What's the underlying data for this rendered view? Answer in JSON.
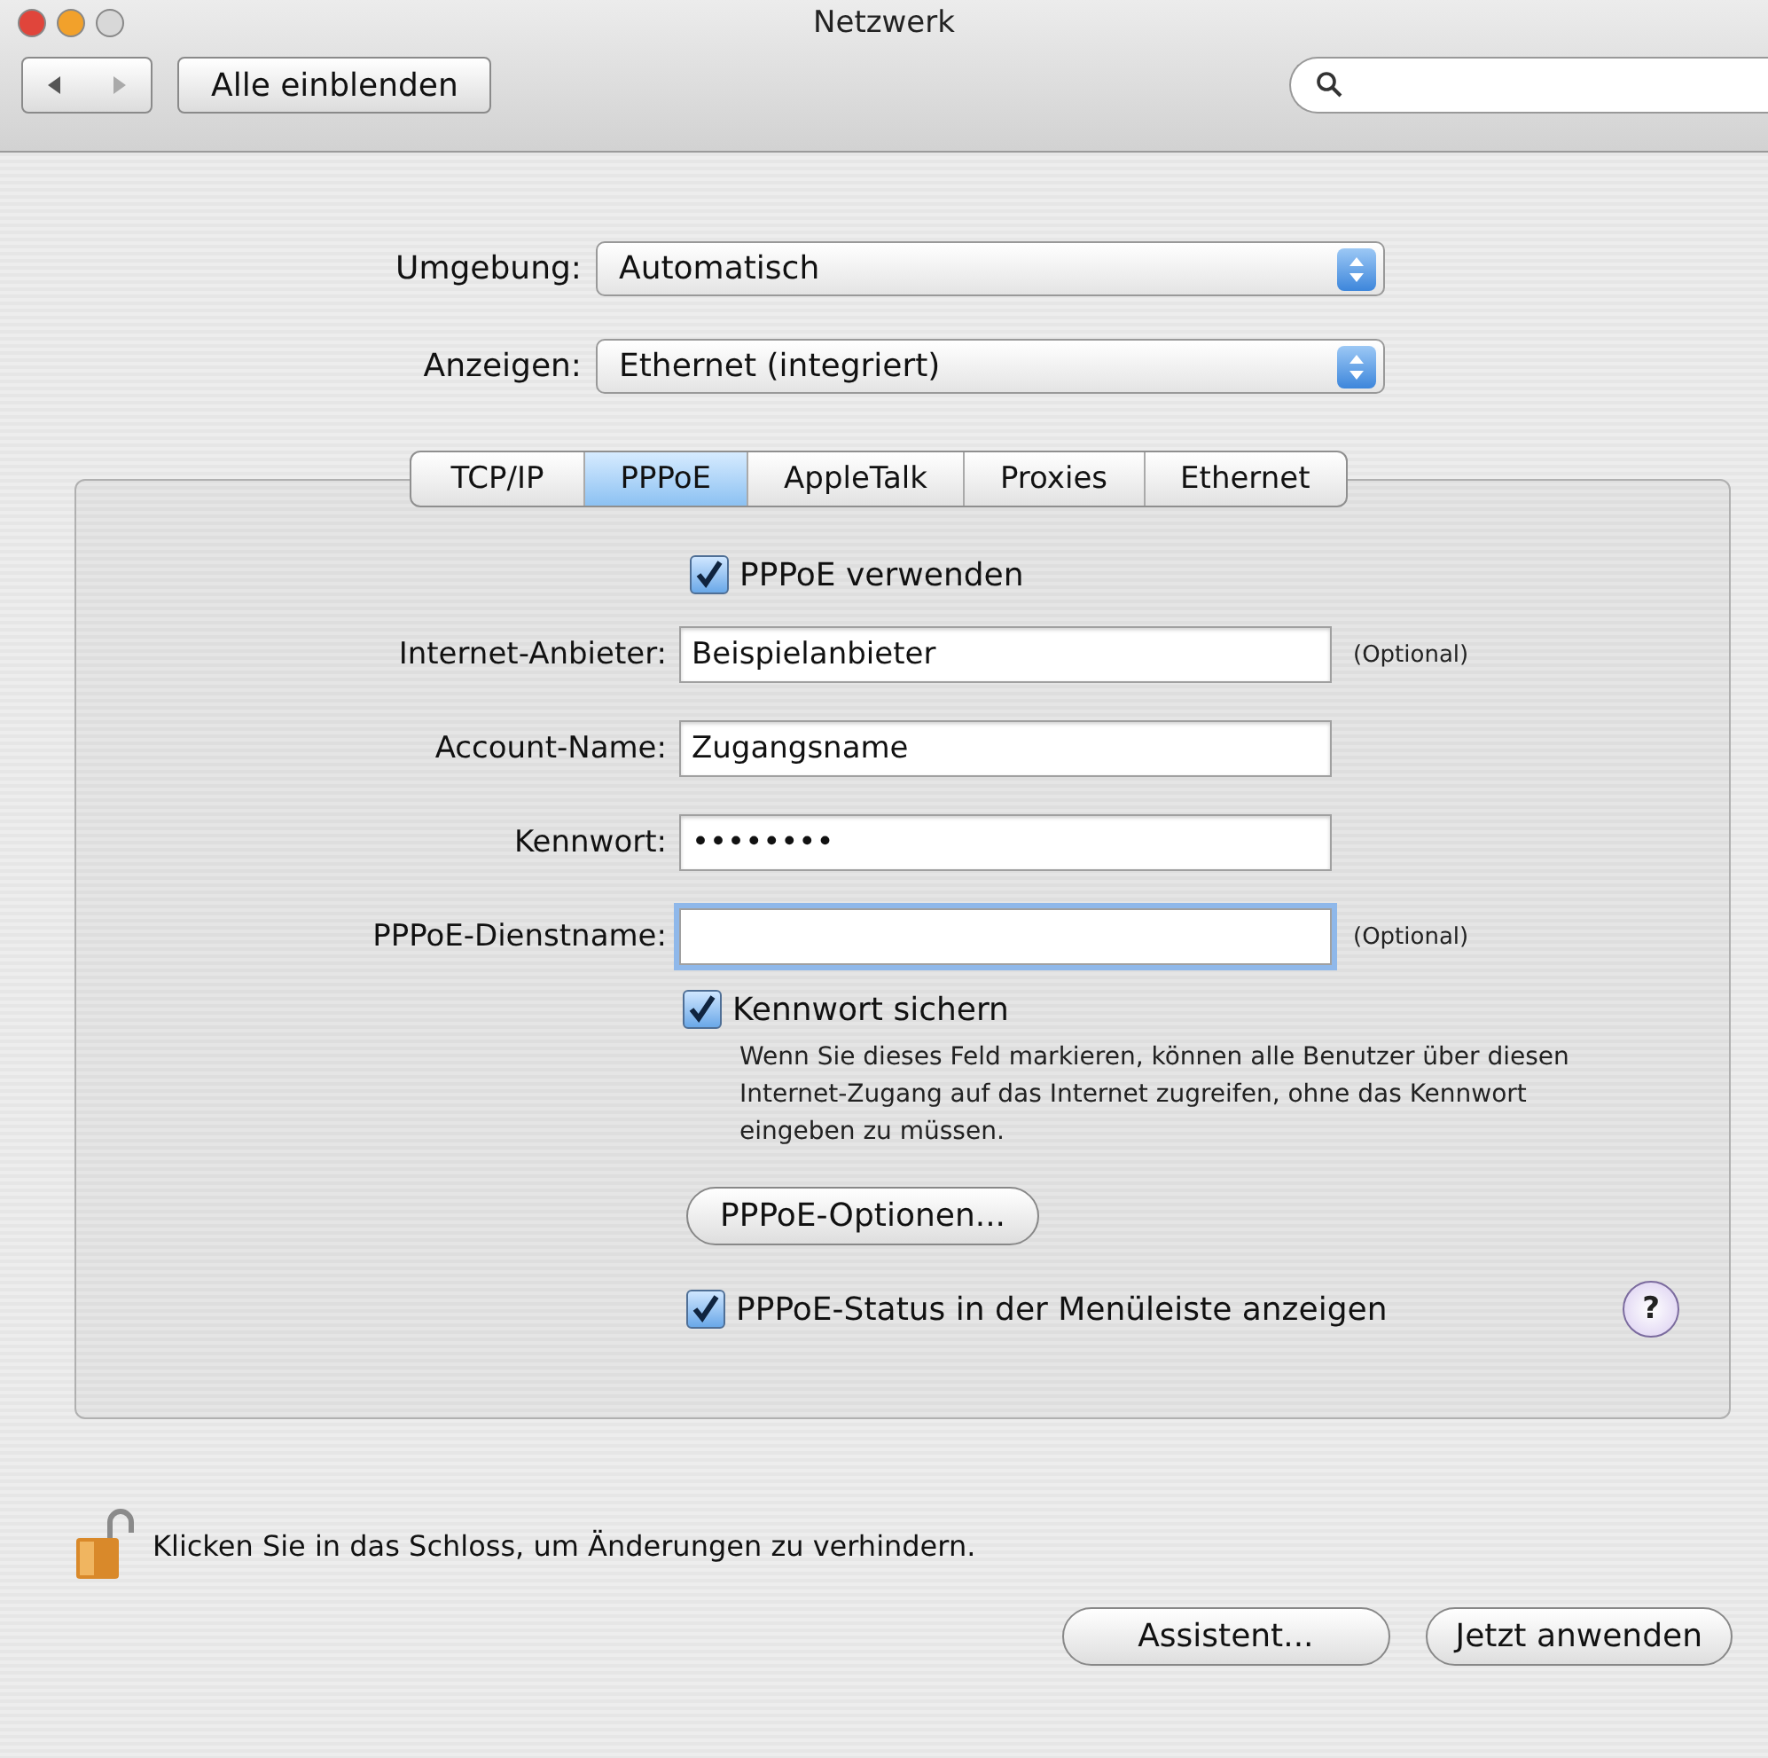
{
  "window": {
    "title": "Netzwerk"
  },
  "toolbar": {
    "show_all": "Alle einblenden"
  },
  "popups": [
    {
      "label": "Umgebung:",
      "value": "Automatisch"
    },
    {
      "label": "Anzeigen:",
      "value": "Ethernet (integriert)"
    }
  ],
  "tabs": [
    {
      "label": "TCP/IP",
      "selected": false
    },
    {
      "label": "PPPoE",
      "selected": true
    },
    {
      "label": "AppleTalk",
      "selected": false
    },
    {
      "label": "Proxies",
      "selected": false
    },
    {
      "label": "Ethernet",
      "selected": false
    }
  ],
  "use_pppoe": {
    "label": "PPPoE verwenden",
    "checked": true
  },
  "fields": [
    {
      "label": "Internet-Anbieter:",
      "value": "Beispielanbieter",
      "note": "(Optional)",
      "focused": false
    },
    {
      "label": "Account-Name:",
      "value": "Zugangsname",
      "focused": false
    },
    {
      "label": "Kennwort:",
      "value": "••••••••",
      "focused": false
    },
    {
      "label": "PPPoE-Dienstname:",
      "note": "(Optional)",
      "focused": true
    }
  ],
  "save_password": {
    "label": "Kennwort sichern",
    "checked": true,
    "description": "Wenn Sie dieses Feld markieren, können alle Benutzer über diesen Internet-Zugang auf das Internet zugreifen, ohne das Kennwort eingeben zu müssen."
  },
  "options_button": "PPPoE-Optionen...",
  "show_status": {
    "label": "PPPoE-Status in der Menüleiste anzeigen",
    "checked": true
  },
  "help": "?",
  "lock_text": "Klicken Sie in das Schloss, um Änderungen zu verhindern.",
  "buttons": [
    "Assistent...",
    "Jetzt anwenden"
  ]
}
